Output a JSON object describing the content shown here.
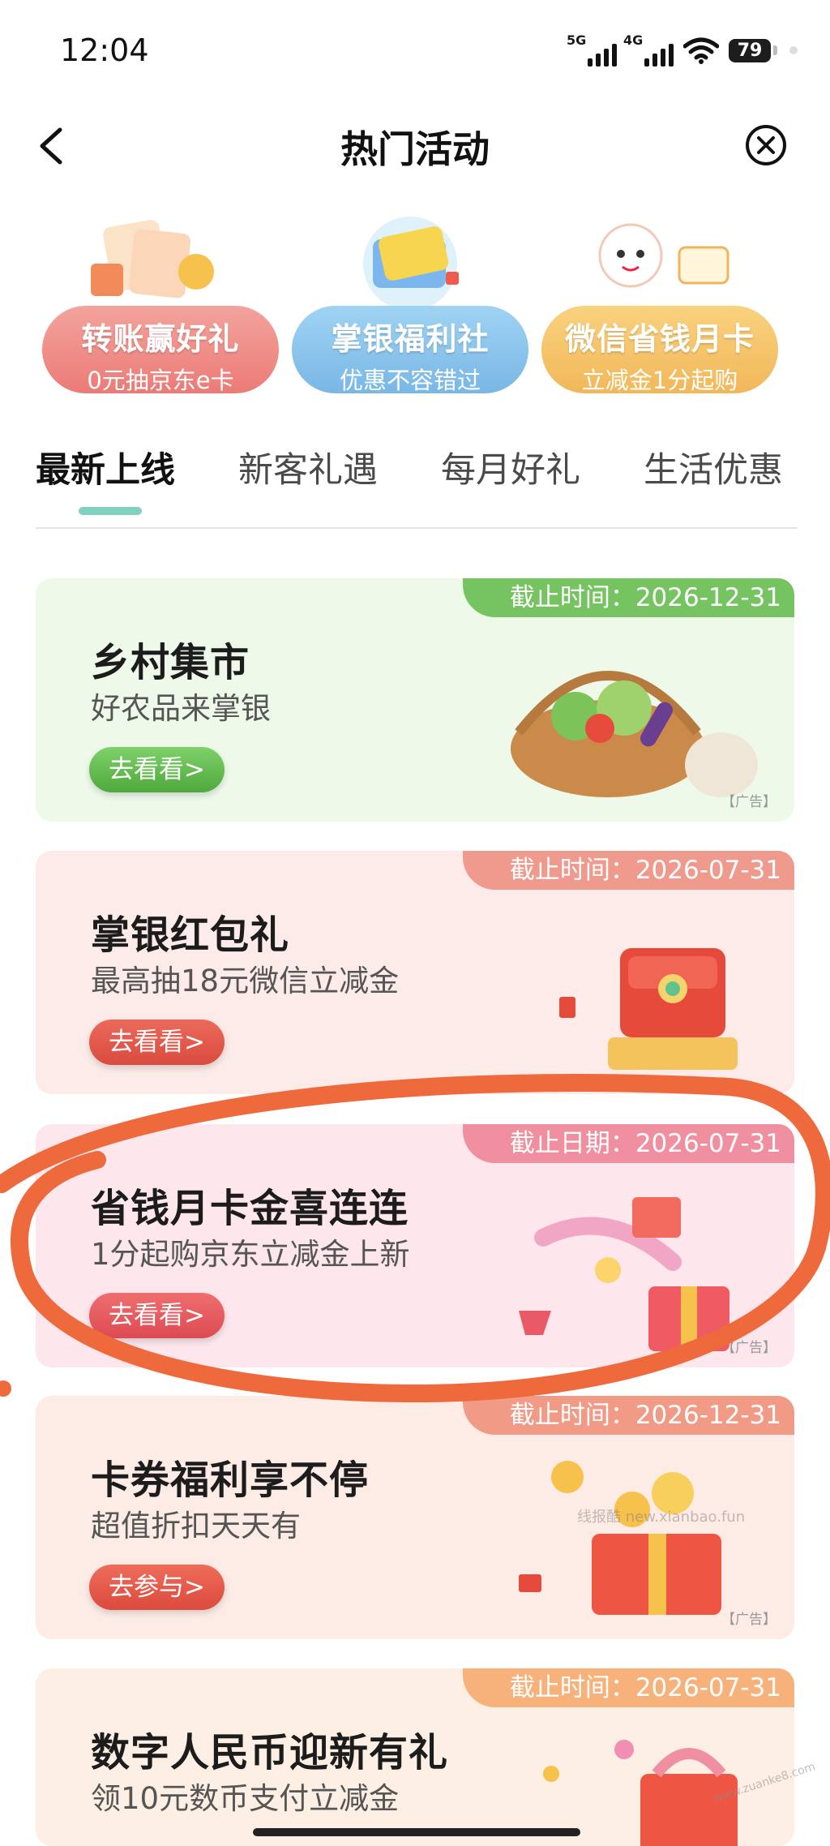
{
  "status_bar": {
    "time": "12:04",
    "net1": "5G",
    "net2": "4G",
    "battery": "79"
  },
  "nav": {
    "title": "热门活动",
    "back_icon": "chevron-left-icon",
    "close_icon": "close-circle-icon"
  },
  "quick_entries": [
    {
      "title": "转账赢好礼",
      "subtitle": "0元抽京东e卡",
      "color": "#f08a86"
    },
    {
      "title": "掌银福利社",
      "subtitle": "优惠不容错过",
      "color": "#7fbde8"
    },
    {
      "title": "微信省钱月卡",
      "subtitle": "立减金1分起购",
      "color": "#f5c46a"
    }
  ],
  "tabs": [
    "最新上线",
    "新客礼遇",
    "每月好礼",
    "生活优惠"
  ],
  "active_tab": "最新上线",
  "cards": [
    {
      "deadline": "截止时间：2026-12-31",
      "title": "乡村集市",
      "subtitle": "好农品来掌银",
      "button": "去看看>",
      "ad": "【广告】"
    },
    {
      "deadline": "截止时间：2026-07-31",
      "title": "掌银红包礼",
      "subtitle": "最高抽18元微信立减金",
      "button": "去看看>"
    },
    {
      "deadline": "截止日期：2026-07-31",
      "title": "省钱月卡金喜连连",
      "subtitle": "1分起购京东立减金上新",
      "button": "去看看>",
      "ad": "【广告】"
    },
    {
      "deadline": "截止时间：2026-12-31",
      "title": "卡券福利享不停",
      "subtitle": "超值折扣天天有",
      "button": "去参与>",
      "ad": "【广告】"
    },
    {
      "deadline": "截止时间：2026-07-31",
      "title": "数字人民币迎新有礼",
      "subtitle": "领10元数币支付立减金"
    }
  ],
  "watermark": "线报酷 new.xianbao.fun",
  "watermark2": "www.zuanke8.com",
  "annotation_color": "#ee6a3d"
}
